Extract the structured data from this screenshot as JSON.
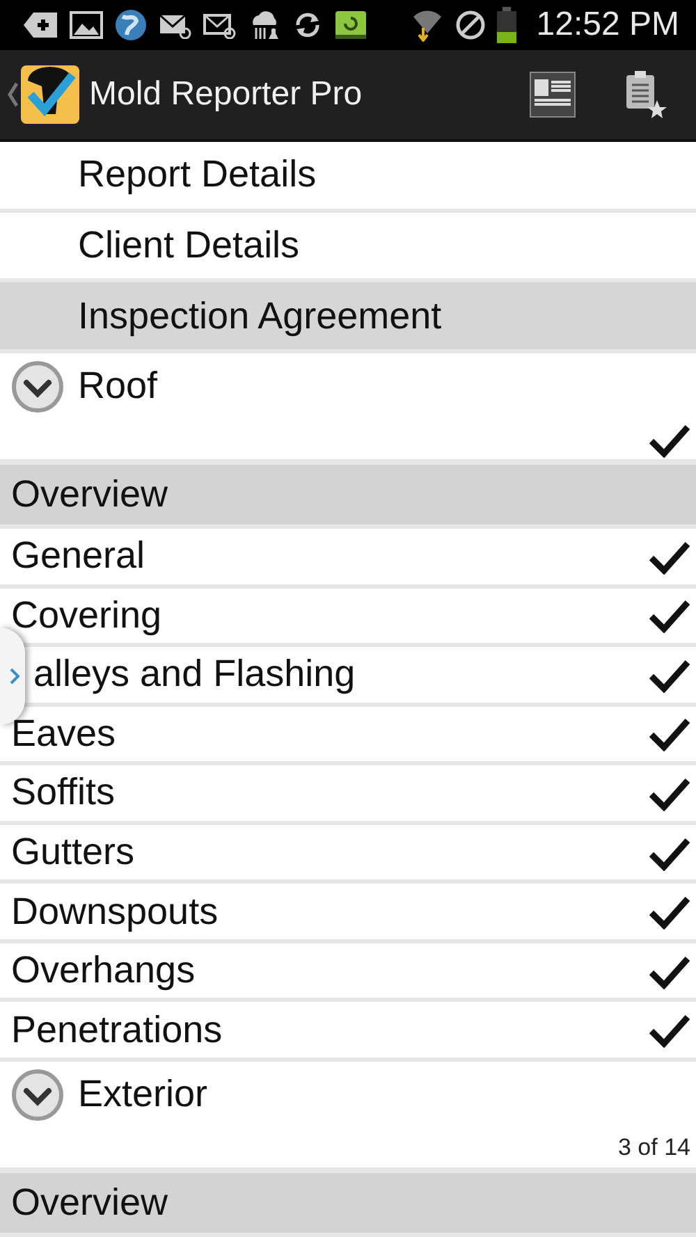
{
  "status_bar": {
    "time": "12:52 PM"
  },
  "app_bar": {
    "title": "Mold Reporter Pro"
  },
  "nav_items": [
    {
      "label": "Report Details",
      "selected": false
    },
    {
      "label": "Client Details",
      "selected": false
    },
    {
      "label": "Inspection Agreement",
      "selected": true
    }
  ],
  "sections": [
    {
      "title": "Roof",
      "checked": true,
      "subsections": [
        {
          "title": "Overview",
          "items": [
            {
              "label": "General",
              "checked": true
            },
            {
              "label": "Covering",
              "checked": true
            },
            {
              "label": "alleys and Flashing",
              "checked": true,
              "kind": "under-handle"
            },
            {
              "label": "Eaves",
              "checked": true
            },
            {
              "label": "Soffits",
              "checked": true
            },
            {
              "label": "Gutters",
              "checked": true
            },
            {
              "label": "Downspouts",
              "checked": true
            },
            {
              "label": "Overhangs",
              "checked": true
            },
            {
              "label": "Penetrations",
              "checked": true
            }
          ]
        }
      ]
    },
    {
      "title": "Exterior",
      "checked": false,
      "progress": "3 of 14",
      "subsections": [
        {
          "title": "Overview"
        }
      ]
    }
  ]
}
